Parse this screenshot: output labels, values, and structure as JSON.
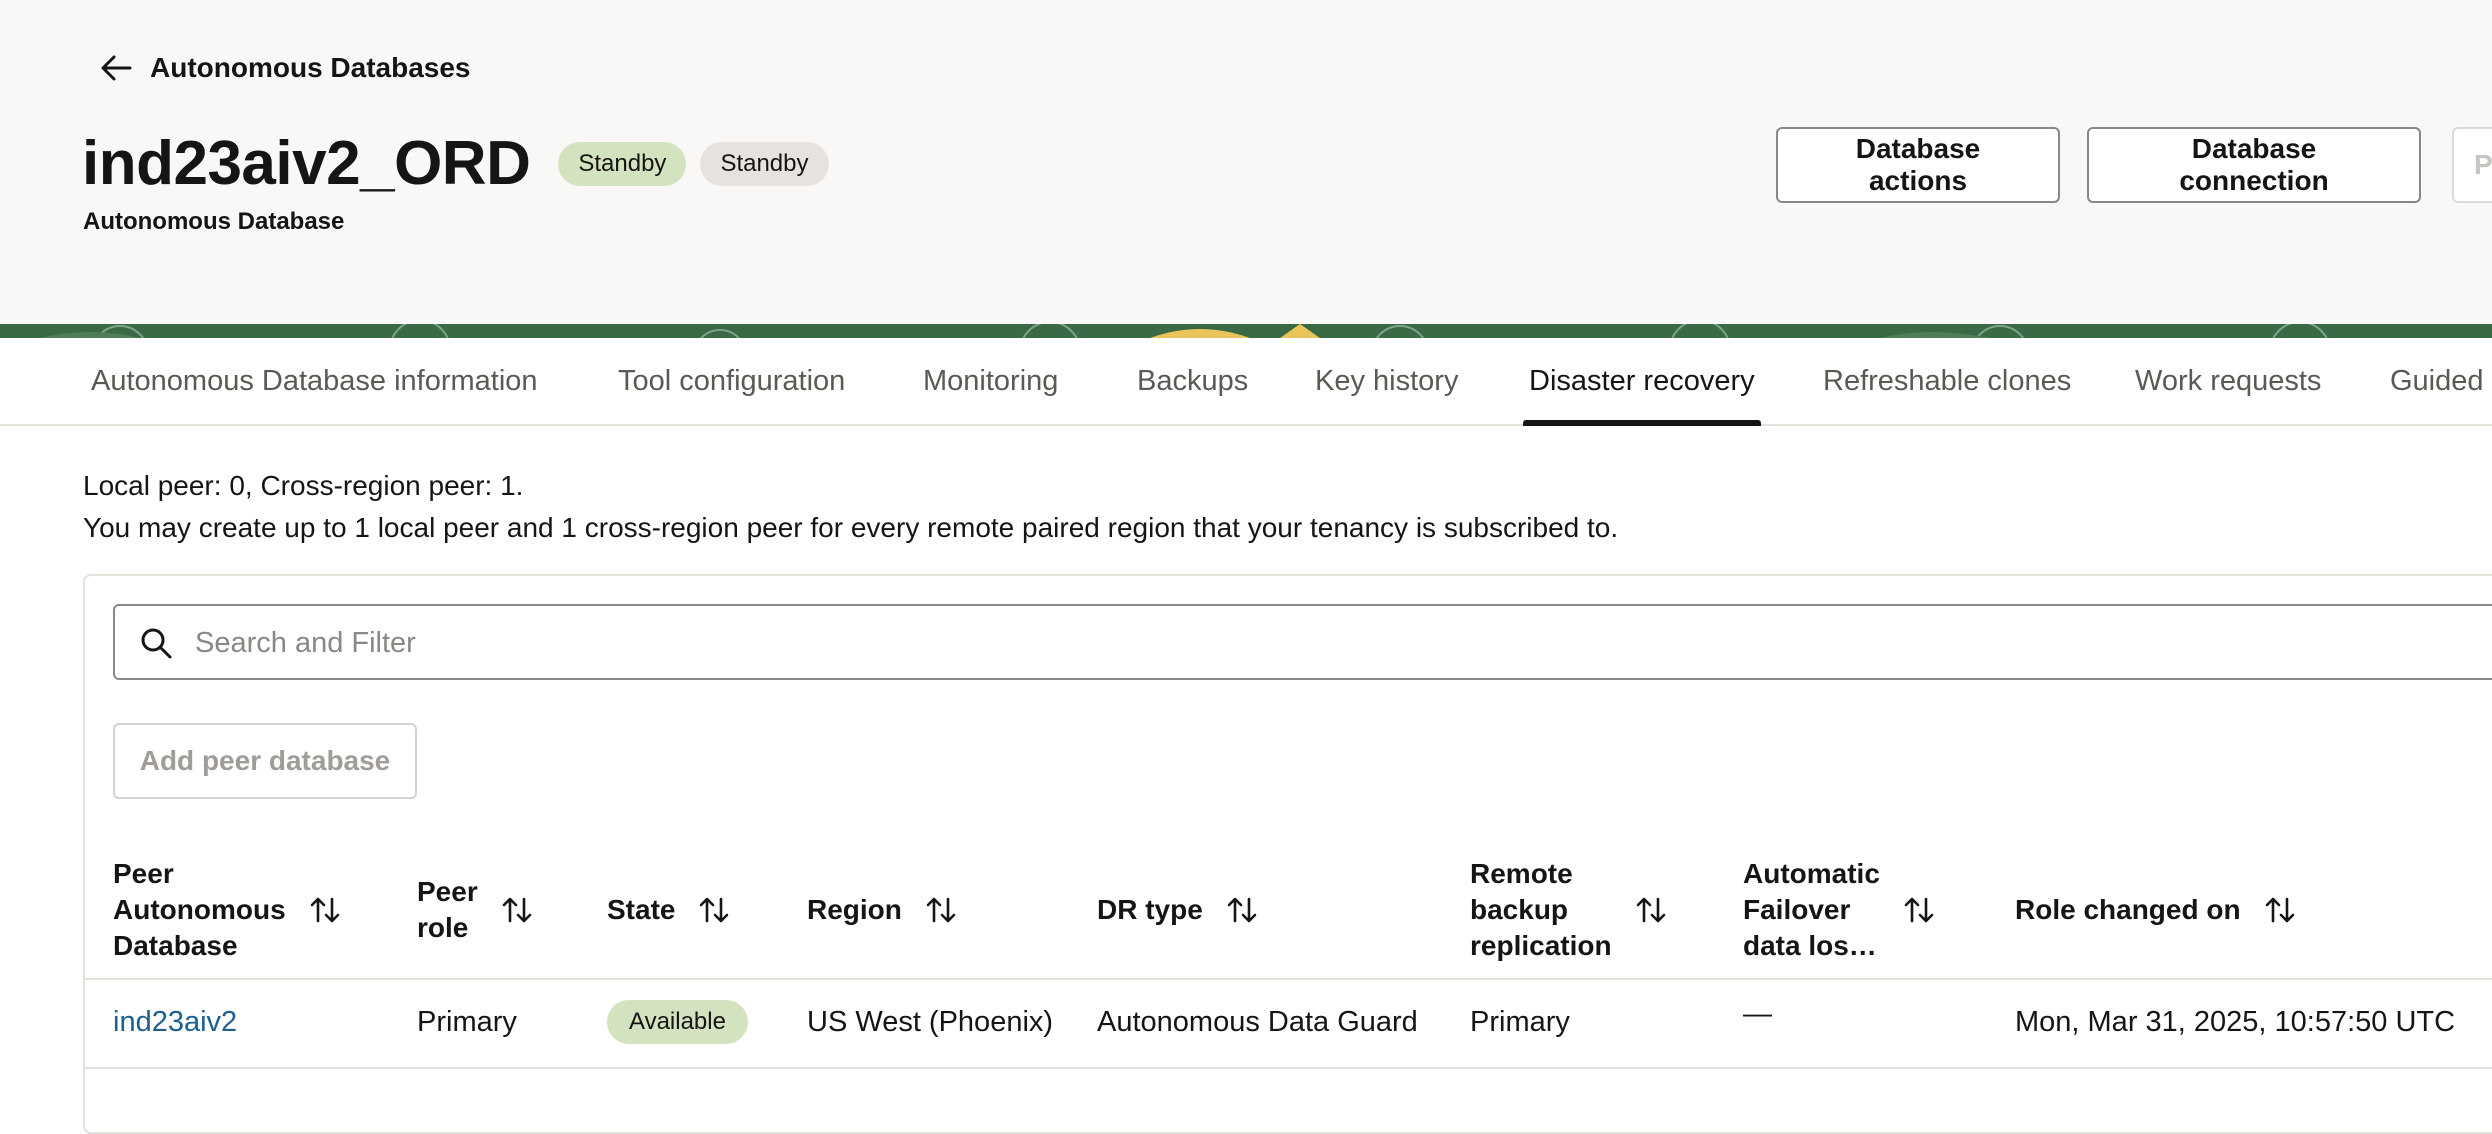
{
  "header": {
    "back_label": "Autonomous Databases",
    "title": "ind23aiv2_ORD",
    "badges": [
      "Standby",
      "Standby"
    ],
    "subtitle": "Autonomous Database",
    "buttons": {
      "db_actions": "Database actions",
      "db_connection": "Database connection",
      "more": "P"
    }
  },
  "tabs": [
    "Autonomous Database information",
    "Tool configuration",
    "Monitoring",
    "Backups",
    "Key history",
    "Disaster recovery",
    "Refreshable clones",
    "Work requests",
    "Guided"
  ],
  "active_tab": "Disaster recovery",
  "info": {
    "line1": "Local peer: 0, Cross-region peer: 1.",
    "line2": "You may create up to 1 local peer and 1 cross-region peer for every remote paired region that your tenancy is subscribed to."
  },
  "search": {
    "placeholder": "Search and Filter",
    "value": ""
  },
  "add_peer_label": "Add peer database",
  "table": {
    "columns": [
      [
        "Peer",
        "Autonomous",
        "Database"
      ],
      [
        "Peer",
        "role"
      ],
      [
        "State"
      ],
      [
        "Region"
      ],
      [
        "DR type"
      ],
      [
        "Remote",
        "backup",
        "replication"
      ],
      [
        "Automatic",
        "Failover",
        "data los…"
      ],
      [
        "Role changed on"
      ]
    ],
    "rows": [
      {
        "peer_db": "ind23aiv2",
        "peer_role": "Primary",
        "state": "Available",
        "region": "US West (Phoenix)",
        "dr_type": "Autonomous Data Guard",
        "remote_backup": "Primary",
        "auto_failover": "—",
        "role_changed_on": "Mon, Mar 31, 2025, 10:57:50 UTC"
      }
    ]
  },
  "colors": {
    "accent": "#161513",
    "link": "#1e5f8c",
    "badge_green": "#d4e3bf",
    "badge_grey": "#e6e3df"
  }
}
